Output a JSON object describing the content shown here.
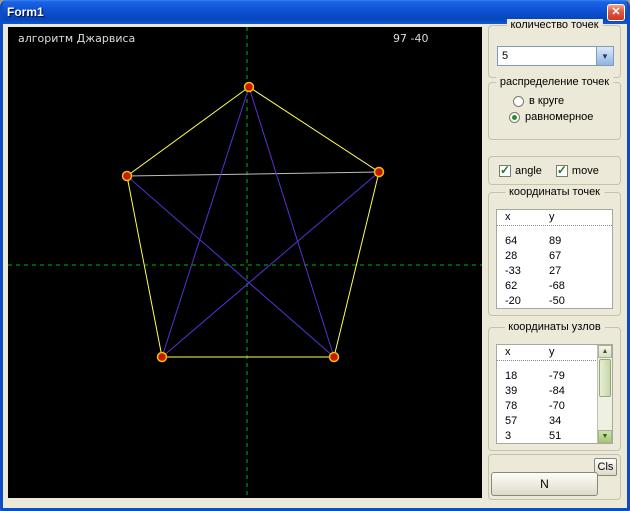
{
  "window": {
    "title": "Form1",
    "close_glyph": "✕"
  },
  "canvas": {
    "algorithm_label": "алгоритм Джарвиса",
    "cursor_coords": "97  -40"
  },
  "points_count": {
    "label": "количество точек",
    "value": "5"
  },
  "distribution": {
    "label": "распределение точек",
    "options": [
      {
        "label": "в круге",
        "selected": false
      },
      {
        "label": "равномерное",
        "selected": true
      }
    ]
  },
  "toggles": {
    "angle": {
      "label": "angle",
      "checked": true
    },
    "move": {
      "label": "move",
      "checked": true
    }
  },
  "points_table": {
    "title": "координаты точек",
    "headers": [
      "x",
      "y"
    ],
    "rows": [
      [
        "64",
        "89"
      ],
      [
        "28",
        "67"
      ],
      [
        "-33",
        "27"
      ],
      [
        "62",
        "-68"
      ],
      [
        "-20",
        "-50"
      ]
    ]
  },
  "nodes_table": {
    "title": "координаты узлов",
    "headers": [
      "x",
      "y"
    ],
    "rows": [
      [
        "18",
        "-79"
      ],
      [
        "39",
        "-84"
      ],
      [
        "78",
        "-70"
      ],
      [
        "57",
        "34"
      ],
      [
        "3",
        "51"
      ]
    ]
  },
  "buttons": {
    "cls": "Cls",
    "n": "N"
  },
  "colors": {
    "hull": "#ffff55",
    "diagonal": "#5b2fd6",
    "chord": "#bdbdbd",
    "axis": "#00b800",
    "vertex_fill": "#cc1500",
    "vertex_stroke": "#e8c400"
  }
}
